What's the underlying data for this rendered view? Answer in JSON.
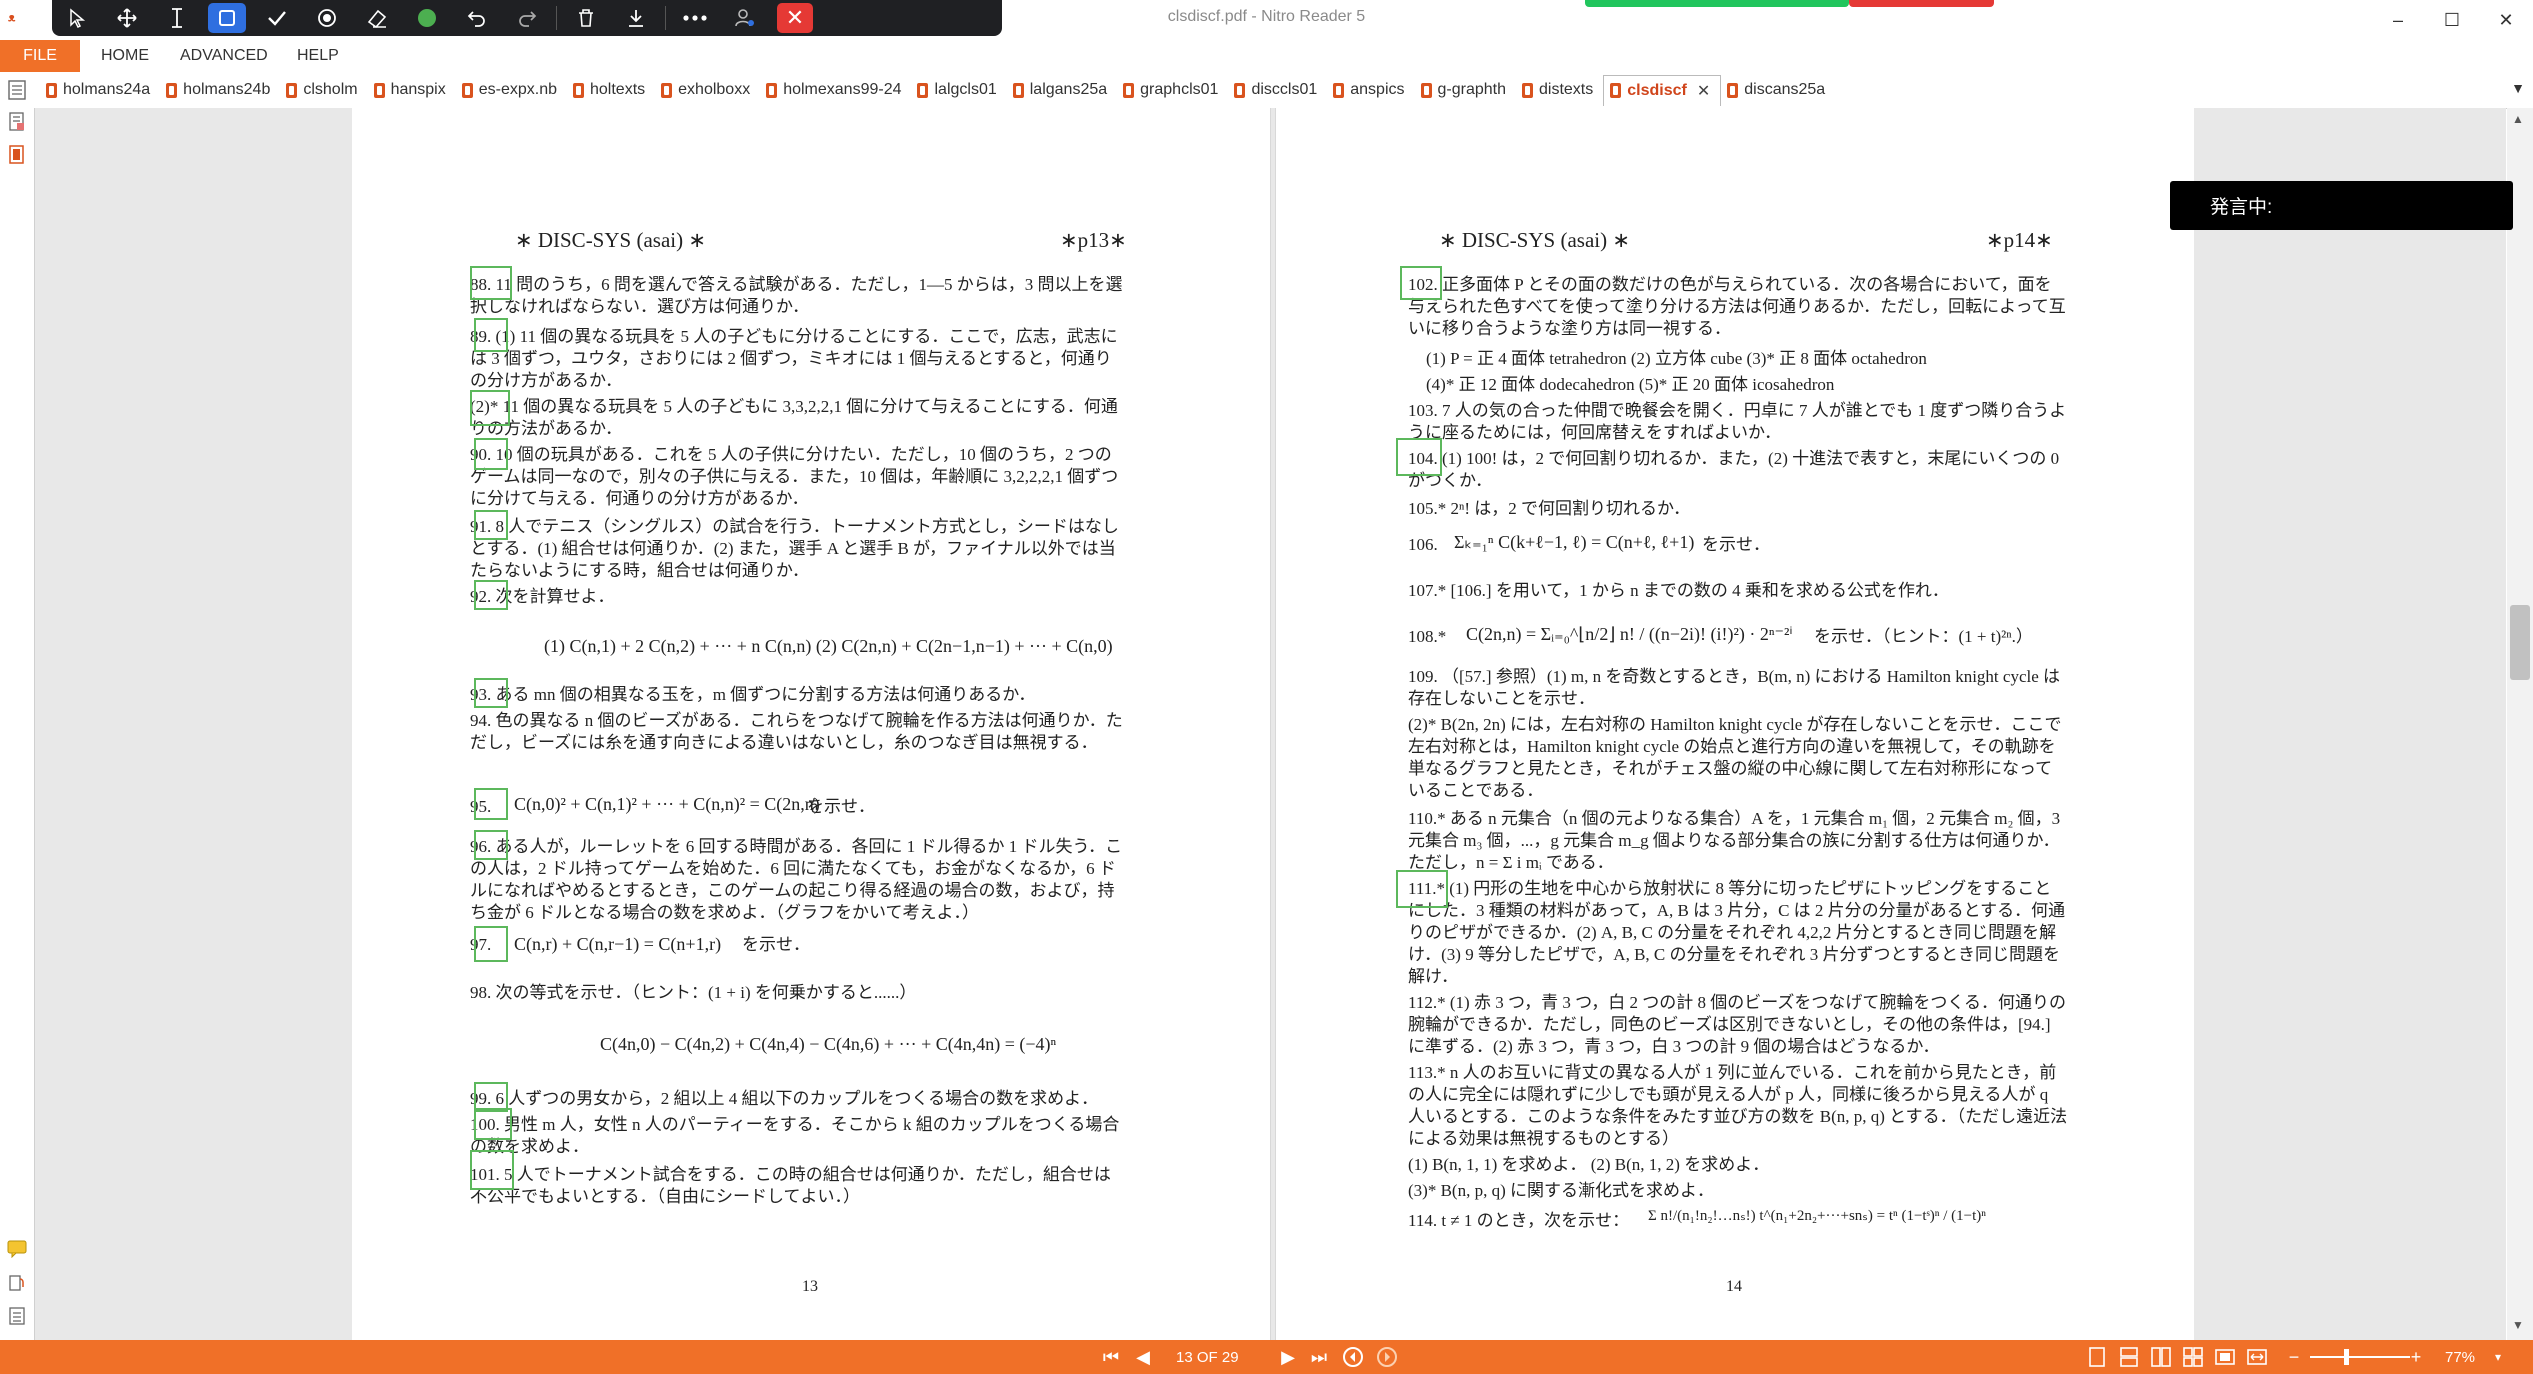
{
  "window": {
    "title": "clsdiscf.pdf - Nitro Reader 5",
    "minimize": "–",
    "maximize": "☐",
    "close": "✕"
  },
  "menu": {
    "file": "FILE",
    "home": "HOME",
    "advanced": "ADVANCED",
    "help": "HELP"
  },
  "tabs": [
    {
      "label": "holmans24a"
    },
    {
      "label": "holmans24b"
    },
    {
      "label": "clsholm"
    },
    {
      "label": "hanspix"
    },
    {
      "label": "es-expx.nb"
    },
    {
      "label": "holtexts"
    },
    {
      "label": "exholboxx"
    },
    {
      "label": "holmexans99-24"
    },
    {
      "label": "lalgcls01"
    },
    {
      "label": "lalgans25a"
    },
    {
      "label": "graphcls01"
    },
    {
      "label": "disccls01"
    },
    {
      "label": "anspics"
    },
    {
      "label": "g-graphth"
    },
    {
      "label": "distexts"
    },
    {
      "label": "clsdiscf",
      "active": true
    },
    {
      "label": "discans25a"
    }
  ],
  "toolbar_icons": [
    "pointer-icon",
    "pan-icon",
    "text-cursor-icon",
    "rectangle-icon",
    "check-icon",
    "stamp-icon",
    "eraser-icon",
    "color-dot-icon",
    "undo-icon",
    "redo-icon",
    "trash-icon",
    "download-icon",
    "more-icon",
    "user-settings-icon",
    "close-icon"
  ],
  "speech_overlay": "発言中:",
  "status": {
    "page_indicator": "13 OF 29",
    "zoom": "77%"
  },
  "page13": {
    "header_left": "∗ DISC-SYS (asai) ∗",
    "header_right": "∗p13∗",
    "page_number": "13",
    "problems": [
      {
        "text": "88. 11 問のうち，6 問を選んで答える試験がある．ただし，1—5 からは，3 問以上を選択しなければならない．選び方は何通りか．"
      },
      {
        "text": "89. (1) 11 個の異なる玩具を 5 人の子どもに分けることにする．ここで，広志，武志には 3 個ずつ，ユウタ，さおりには 2 個ずつ，ミキオには 1 個与えるとすると，何通りの分け方があるか．"
      },
      {
        "text": "(2)* 11 個の異なる玩具を 5 人の子どもに 3,3,2,2,1 個に分けて与えることにする．何通りの方法があるか．"
      },
      {
        "text": "90. 10 個の玩具がある．これを 5 人の子供に分けたい．ただし，10 個のうち，2 つのゲームは同一なので，別々の子供に与える．また，10 個は，年齢順に 3,2,2,2,1 個ずつに分けて与える．何通りの分け方があるか．"
      },
      {
        "text": "91. 8 人でテニス（シングルス）の試合を行う．トーナメント方式とし，シードはなしとする．(1) 組合せは何通りか．(2) また，選手 A と選手 B が，ファイナル以外では当たらないようにする時，組合せは何通りか．"
      },
      {
        "text": "92. 次を計算せよ．"
      },
      {
        "text": "93. ある mn 個の相異なる玉を，m 個ずつに分割する方法は何通りあるか．"
      },
      {
        "text": "94. 色の異なる n 個のビーズがある．これらをつなげて腕輪を作る方法は何通りか．ただし，ビーズには糸を通す向きによる違いはないとし，糸のつなぎ目は無視する．"
      },
      {
        "text": "95. を示せ．"
      },
      {
        "text": "96. ある人が，ルーレットを 6 回する時間がある．各回に 1 ドル得るか 1 ドル失う．この人は，2 ドル持ってゲームを始めた．6 回に満たなくても，お金がなくなるか，6 ドルになればやめるとするとき，このゲームの起こり得る経過の場合の数，および，持ち金が 6 ドルとなる場合の数を求めよ．（グラフをかいて考えよ．）"
      },
      {
        "text": "97. を示せ．"
      },
      {
        "text": "98. 次の等式を示せ．（ヒント：(1 + i) を何乗かすると......）"
      },
      {
        "text": "99. 6 人ずつの男女から，2 組以上 4 組以下のカップルをつくる場合の数を求めよ．"
      },
      {
        "text": "100. 男性 m 人，女性 n 人のパーティーをする．そこから k 組のカップルをつくる場合の数を求めよ．"
      },
      {
        "text": "101. 5 人でトーナメント試合をする．この時の組合せは何通りか．ただし，組合せは不公平でもよいとする．（自由にシードしてよい．）"
      }
    ],
    "math": [
      "(1)  C(n,1) + 2 C(n,2) + ··· + n C(n,n)     (2)  C(2n,n) + C(2n−1,n−1) + ··· + C(n,0)",
      "C(n,0)² + C(n,1)² + ··· + C(n,n)² = C(2n,n)",
      "C(n,r) + C(n,r−1) = C(n+1,r)",
      "C(4n,0) − C(4n,2) + C(4n,4) − C(4n,6) + ··· + C(4n,4n) = (−4)ⁿ"
    ]
  },
  "page14": {
    "header_left": "∗ DISC-SYS (asai) ∗",
    "header_right": "∗p14∗",
    "page_number": "14",
    "problems": [
      {
        "text": "102. 正多面体 P とその面の数だけの色が与えられている．次の各場合において，面を与えられた色すべてを使って塗り分ける方法は何通りあるか．ただし，回転によって互いに移り合うような塗り方は同一視する．"
      },
      {
        "text": "(1) P = 正 4 面体 tetrahedron    (2) 立方体 cube    (3)* 正 8 面体 octahedron"
      },
      {
        "text": "(4)* 正 12 面体 dodecahedron    (5)* 正 20 面体 icosahedron"
      },
      {
        "text": "103. 7 人の気の合った仲間で晩餐会を開く．円卓に 7 人が誰とでも 1 度ずつ隣り合うように座るためには，何回席替えをすればよいか．"
      },
      {
        "text": "104. (1) 100! は，2 で何回割り切れるか．また，(2) 十進法で表すと，末尾にいくつの 0 がつくか．"
      },
      {
        "text": "105.* 2ⁿ! は，2 で何回割り切れるか．"
      },
      {
        "text": "106. を示せ．"
      },
      {
        "text": "107.* [106.] を用いて，1 から n までの数の 4 乗和を求める公式を作れ．"
      },
      {
        "text": "108.* を示せ．（ヒント：(1 + t)²ⁿ.）"
      },
      {
        "text": "109. （[57.] 参照）(1) m, n を奇数とするとき，B(m, n) における Hamilton knight cycle は存在しないことを示せ．"
      },
      {
        "text": "(2)* B(2n, 2n) には，左右対称の Hamilton knight cycle が存在しないことを示せ．ここで左右対称とは，Hamilton knight cycle の始点と進行方向の違いを無視して，その軌跡を単なるグラフと見たとき，それがチェス盤の縦の中心線に関して左右対称形になっていることである．"
      },
      {
        "text": "110.* ある n 元集合（n 個の元よりなる集合）A を，1 元集合 m₁ 個，2 元集合 m₂ 個，3 元集合 m₃ 個，...，g 元集合 m_g 個よりなる部分集合の族に分割する仕方は何通りか．ただし，n = Σ i mᵢ である．"
      },
      {
        "text": "111.* (1) 円形の生地を中心から放射状に 8 等分に切ったピザにトッピングをすることにした．3 種類の材料があって，A, B は 3 片分，C は 2 片分の分量があるとする．何通りのピザができるか．(2) A, B, C の分量をそれぞれ 4,2,2 片分とするとき同じ問題を解け．(3) 9 等分したピザで，A, B, C の分量をそれぞれ 3 片分ずつとするとき同じ問題を解け．"
      },
      {
        "text": "112.* (1) 赤 3 つ，青 3 つ，白 2 つの計 8 個のビーズをつなげて腕輪をつくる．何通りの腕輪ができるか．ただし，同色のビーズは区別できないとし，その他の条件は，[94.] に準ずる．(2) 赤 3 つ，青 3 つ，白 3 つの計 9 個の場合はどうなるか．"
      },
      {
        "text": "113.* n 人のお互いに背丈の異なる人が 1 列に並んでいる．これを前から見たとき，前の人に完全には隠れずに少しでも頭が見える人が p 人，同様に後ろから見える人が q 人いるとする．このような条件をみたす並び方の数を B(n, p, q) とする．（ただし遠近法による効果は無視するものとする）"
      },
      {
        "text": "(1) B(n, 1, 1) を求めよ．    (2) B(n, 1, 2) を求めよ．"
      },
      {
        "text": "(3)* B(n, p, q) に関する漸化式を求めよ．"
      },
      {
        "text": "114. t ≠ 1 のとき，次を示せ："
      }
    ],
    "math": [
      "Σₖ₌₁ⁿ C(k+ℓ−1, ℓ) = C(n+ℓ, ℓ+1)",
      "C(2n,n) = Σᵢ₌₀^⌊n/2⌋ n! / ((n−2i)! (i!)²) · 2ⁿ⁻²ⁱ",
      "Σ n!/(n₁!n₂!…nₛ!) t^(n₁+2n₂+···+snₛ) = tⁿ (1−tˢ)ⁿ / (1−t)ⁿ"
    ]
  }
}
